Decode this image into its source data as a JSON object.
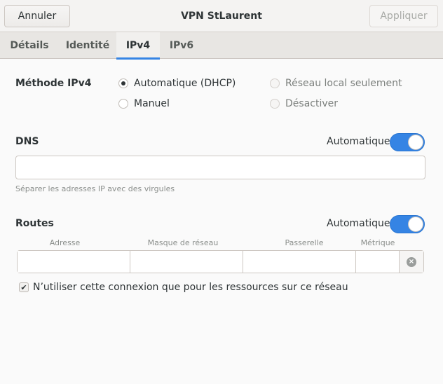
{
  "header": {
    "cancel_label": "Annuler",
    "title": "VPN StLaurent",
    "apply_label": "Appliquer"
  },
  "tabs": [
    {
      "label": "Détails",
      "active": false
    },
    {
      "label": "Identité",
      "active": false
    },
    {
      "label": "IPv4",
      "active": true
    },
    {
      "label": "IPv6",
      "active": false
    }
  ],
  "ipv4": {
    "method_label": "Méthode IPv4",
    "methods": {
      "auto": "Automatique (DHCP)",
      "local": "Réseau local seulement",
      "manual": "Manuel",
      "disable": "Désactiver"
    },
    "selected_method": "auto"
  },
  "dns": {
    "label": "DNS",
    "auto_label": "Automatique",
    "auto_on": true,
    "value": "",
    "hint": "Séparer les adresses IP avec des virgules"
  },
  "routes": {
    "label": "Routes",
    "auto_label": "Automatique",
    "auto_on": true,
    "columns": {
      "address": "Adresse",
      "netmask": "Masque de réseau",
      "gateway": "Passerelle",
      "metric": "Métrique"
    }
  },
  "only_resources": {
    "label": "N’utiliser cette connexion que pour les ressources sur ce réseau",
    "checked": true
  },
  "colors": {
    "accent": "#3584e4"
  }
}
